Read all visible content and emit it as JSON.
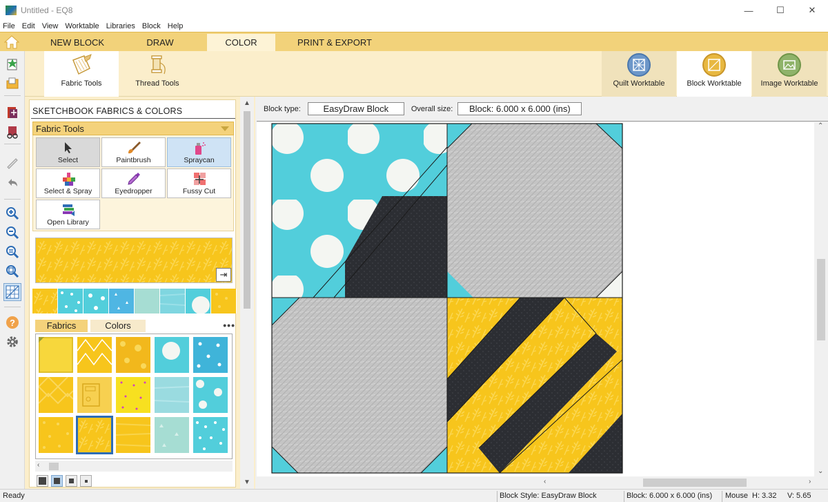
{
  "window": {
    "title": "Untitled - EQ8",
    "controls": [
      "—",
      "☐",
      "✕"
    ]
  },
  "menu": [
    "File",
    "Edit",
    "View",
    "Worktable",
    "Libraries",
    "Block",
    "Help"
  ],
  "ribbon": {
    "tabs": [
      "NEW BLOCK",
      "DRAW",
      "COLOR",
      "PRINT & EXPORT"
    ],
    "active_tab": "COLOR",
    "tools": [
      "Fabric Tools",
      "Thread Tools"
    ],
    "worktables": [
      "Quilt Worktable",
      "Block Worktable",
      "Image Worktable"
    ]
  },
  "panel": {
    "title": "SKETCHBOOK FABRICS & COLORS",
    "fabric_tools_header": "Fabric Tools",
    "tools": [
      "Select",
      "Paintbrush",
      "Spraycan",
      "Select & Spray",
      "Eyedropper",
      "Fussy Cut",
      "Open Library"
    ],
    "library_tabs": [
      "Fabrics",
      "Colors"
    ],
    "more": "•••"
  },
  "info": {
    "block_type_label": "Block type:",
    "block_type": "EasyDraw Block",
    "overall_size_label": "Overall size:",
    "overall_size": "Block: 6.000 x 6.000 (ins)"
  },
  "status": {
    "ready": "Ready",
    "block_style": "Block Style: EasyDraw Block",
    "block_size": "Block: 6.000 x 6.000 (ins)",
    "mouse_label": "Mouse",
    "h": "H:  3.32",
    "v": "V:  5.65"
  },
  "colors": {
    "yellow": "#f7c51c",
    "aqua": "#52cedb",
    "gray": "#c4c4c4",
    "charcoal": "#2c2e33",
    "ribbon": "#f2d27a",
    "selection": "#2d6cb5"
  }
}
